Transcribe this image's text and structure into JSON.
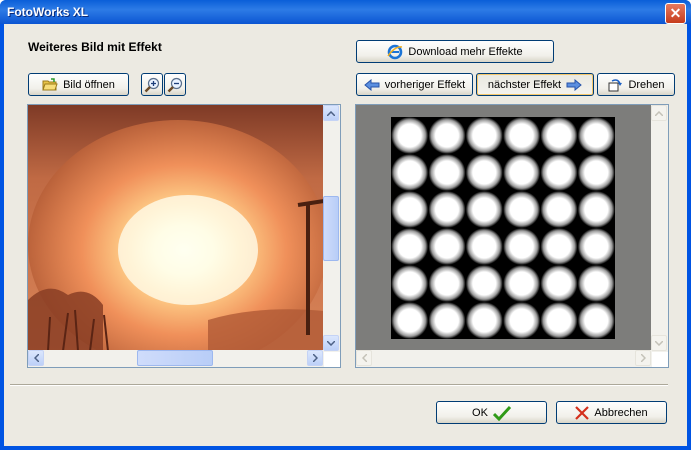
{
  "window": {
    "title": "FotoWorks XL",
    "close_symbol": "✕"
  },
  "heading": "Weiteres Bild mit Effekt",
  "toolbar": {
    "open_label": "Bild öffnen",
    "download_label": "Download mehr Effekte",
    "prev_label": "vorheriger Effekt",
    "next_label": "nächster Effekt",
    "rotate_label": "Drehen"
  },
  "icons": {
    "open": "folder-open-icon",
    "zoom_in": "zoom-in-icon",
    "zoom_out": "zoom-out-icon",
    "download": "internet-explorer-icon",
    "prev": "arrow-left-icon",
    "next": "arrow-right-icon",
    "rotate": "rotate-icon",
    "ok": "checkmark-icon",
    "cancel": "x-icon"
  },
  "preview": {
    "grid_rows": 6,
    "grid_cols": 6
  },
  "footer": {
    "ok_label": "OK",
    "cancel_label": "Abbrechen"
  },
  "colors": {
    "accent": "#0054e3",
    "ok_check": "#2f9a17",
    "cancel_x": "#d4301d",
    "effect_bg": "#7d7d7b"
  }
}
